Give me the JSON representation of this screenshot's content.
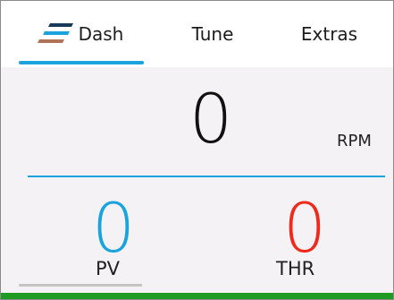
{
  "tabs": [
    {
      "label": "Dash",
      "active": true
    },
    {
      "label": "Tune",
      "active": false
    },
    {
      "label": "Extras",
      "active": false
    }
  ],
  "dash": {
    "rpm_value": "0",
    "rpm_unit": "RPM",
    "pv_value": "0",
    "pv_label": "PV",
    "thr_value": "0",
    "thr_label": "THR"
  },
  "colors": {
    "accent": "#1aa3dd",
    "pv": "#1aa3dd",
    "thr": "#ee2a1c",
    "bottom_bar": "#1f9a22"
  }
}
